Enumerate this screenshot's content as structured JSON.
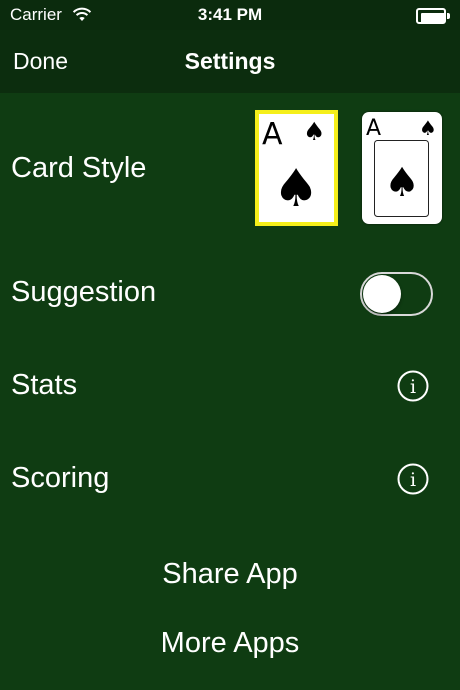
{
  "status_bar": {
    "carrier": "Carrier",
    "time": "3:41 PM",
    "wifi_icon": "wifi-icon",
    "battery_icon": "battery-icon"
  },
  "nav": {
    "done_label": "Done",
    "title": "Settings"
  },
  "settings": {
    "card_style_label": "Card Style",
    "card_options": [
      {
        "rank": "A",
        "suit": "♠",
        "selected": true
      },
      {
        "rank": "A",
        "suit": "♠",
        "selected": false
      }
    ],
    "suggestion_label": "Suggestion",
    "suggestion_on": false,
    "stats_label": "Stats",
    "scoring_label": "Scoring",
    "info_icon_glyph": "i"
  },
  "links": {
    "share_app": "Share App",
    "more_apps": "More Apps"
  },
  "colors": {
    "background": "#0f3c12",
    "nav_background": "#0c2d0e",
    "selection_border": "#f5ef1a"
  }
}
